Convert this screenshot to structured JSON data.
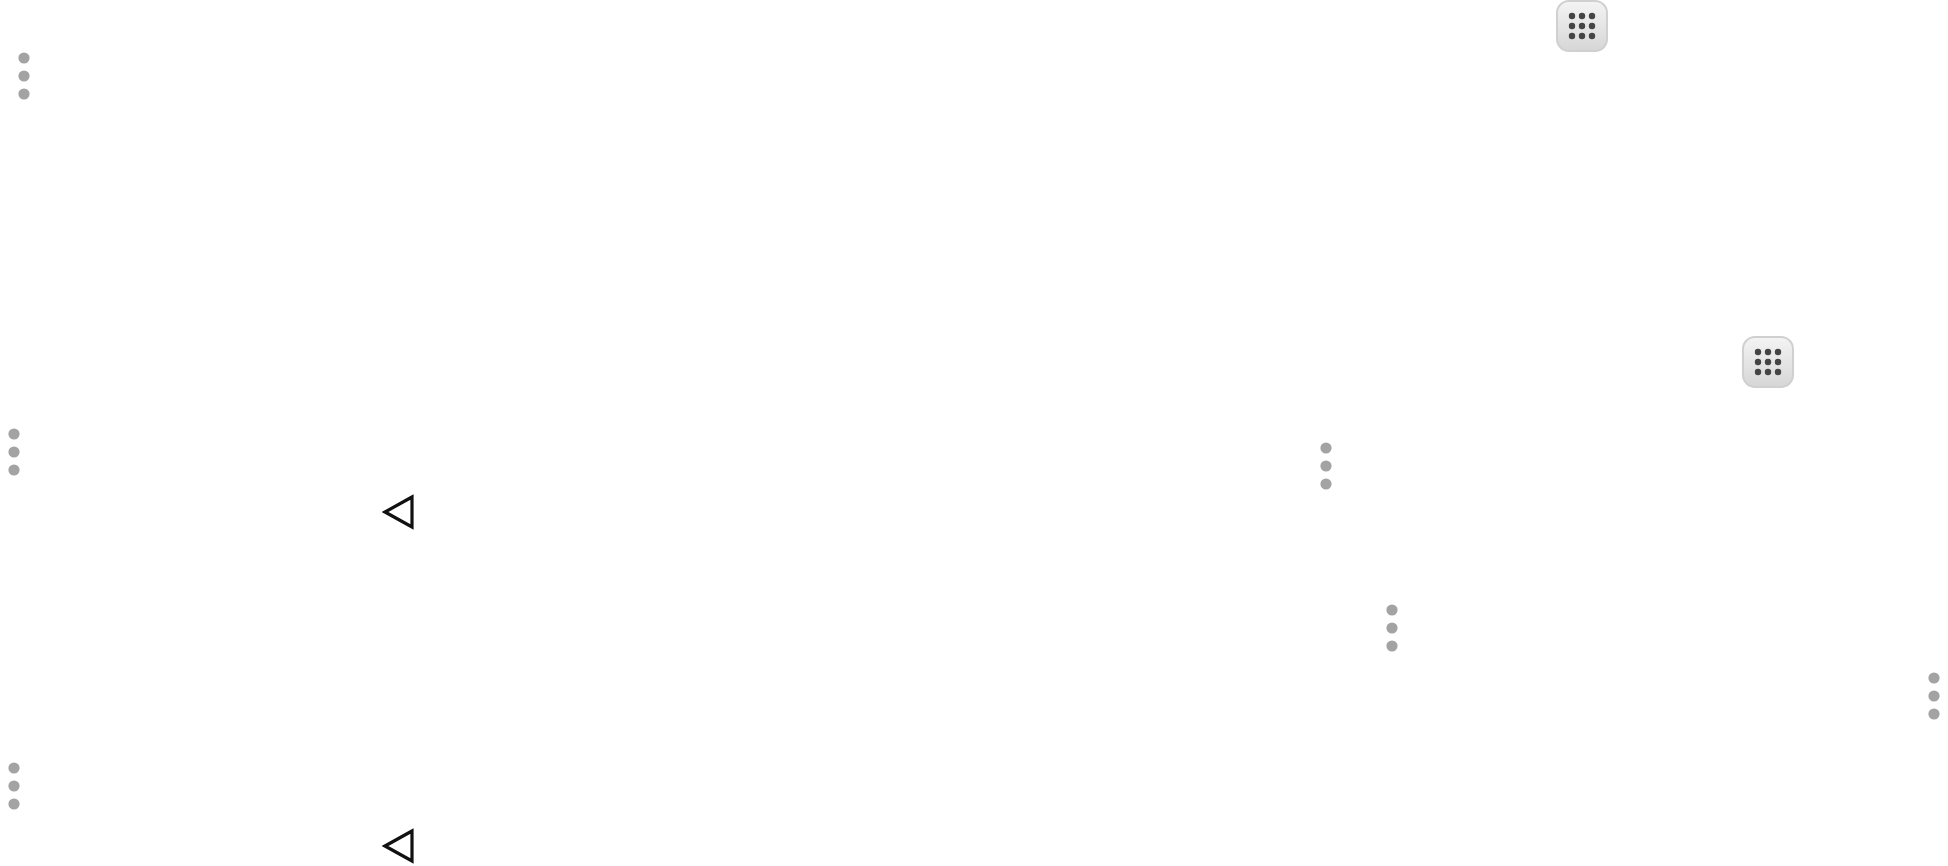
{
  "icons": [
    {
      "kind": "apps"
    },
    {
      "kind": "menu"
    },
    {
      "kind": "apps"
    },
    {
      "kind": "menu"
    },
    {
      "kind": "menu"
    },
    {
      "kind": "back"
    },
    {
      "kind": "menu"
    },
    {
      "kind": "menu"
    },
    {
      "kind": "menu"
    },
    {
      "kind": "back"
    }
  ]
}
